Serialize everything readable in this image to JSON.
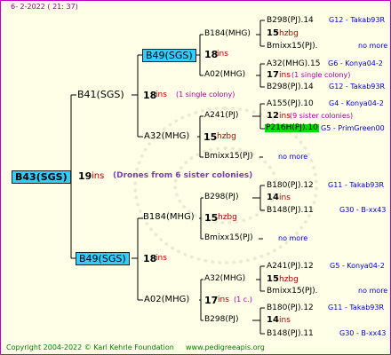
{
  "header": "6-  2-2022 ( 21: 37)",
  "footer": {
    "copyright": "Copyright 2004-2022 © Karl Kehrle Foundation",
    "site": "www.pedigreeapis.org"
  },
  "main": {
    "name": "B43(SGS)",
    "num": "19",
    "ins": "ins",
    "drones": "(Drones from 6 sister colonies)"
  },
  "gen1": {
    "top": {
      "name": "B41(SGS)",
      "num": "18",
      "ins": "ins",
      "note": "(1 single colony)"
    },
    "bottom": {
      "name": "B49(SGS)",
      "num": "18",
      "ins": "ins"
    }
  },
  "gen2": [
    {
      "name": "B49(SGS)",
      "num": "18",
      "ins": "ins"
    },
    {
      "name": "A32(MHG)",
      "num": "15",
      "ins": "hzbg"
    },
    {
      "name": "B184(MHG)",
      "num": "15",
      "ins": "hzbg"
    },
    {
      "name": "A02(MHG)",
      "num": "17",
      "ins": "ins",
      "note": "(1 c.)"
    }
  ],
  "gen3": [
    {
      "name": "B184(MHG)",
      "num": "15",
      "ins": "hzbg"
    },
    {
      "name": "A02(MHG)",
      "num": "17",
      "ins": "ins",
      "note": "(1 single colony)"
    },
    {
      "name": "A241(PJ)",
      "num": "12",
      "ins": "ins",
      "note": "(9 sister colonies)"
    },
    {
      "name": "Bmixx15(PJ)",
      "more": "no more"
    },
    {
      "name": "B298(PJ)",
      "num": "14",
      "ins": "ins"
    },
    {
      "name": "Bmixx15(PJ)",
      "more": "no more"
    },
    {
      "name": "A32(MHG)",
      "num": "15",
      "ins": "hzbg"
    },
    {
      "name": "B298(PJ)",
      "num": "14",
      "ins": "ins"
    }
  ],
  "gen4": [
    {
      "name": "B298(PJ).14",
      "right": "G12 - Takab93R"
    },
    {
      "name": "Bmixx15(PJ).",
      "right": "no more"
    },
    {
      "name": "A32(MHG).15",
      "right": "G6 - Konya04-2"
    },
    {
      "name": "B298(PJ).14",
      "right": "G12 - Takab93R"
    },
    {
      "name": "A155(PJ).10",
      "right": "G4 - Konya04-2"
    },
    {
      "name": "P216H(PJ).10",
      "right": "G5 - PrimGreen00"
    },
    {
      "name": "B180(PJ).12",
      "right": "G11 - Takab93R"
    },
    {
      "name": "B148(PJ).11",
      "right": "G30 - B-xx43"
    },
    {
      "name": "A241(PJ).12",
      "right": "G5 - Konya04-2"
    },
    {
      "name": "Bmixx15(PJ).",
      "right": "no more"
    },
    {
      "name": "B180(PJ).12",
      "right": "G11 - Takab93R"
    },
    {
      "name": "B148(PJ).11",
      "right": "G30 - B-xx43"
    }
  ]
}
